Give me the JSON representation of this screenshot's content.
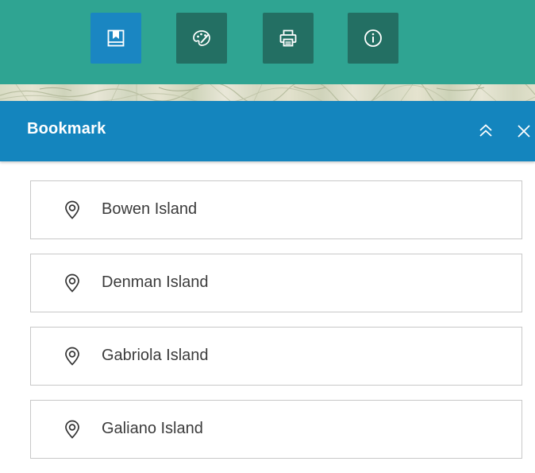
{
  "toolbar": {
    "buttons": [
      {
        "name": "bookmark",
        "icon": "bookmark-icon",
        "active": true
      },
      {
        "name": "basemap",
        "icon": "palette-icon",
        "active": false
      },
      {
        "name": "print",
        "icon": "printer-icon",
        "active": false
      },
      {
        "name": "about",
        "icon": "info-icon",
        "active": false
      }
    ],
    "colors": {
      "bar": "#2fa492",
      "button": "#236f63",
      "active_button": "#1a86c2"
    }
  },
  "panel": {
    "title": "Bookmark",
    "collapse_icon": "double-chevron-up-icon",
    "close_icon": "close-icon",
    "header_color": "#1485be"
  },
  "bookmarks": [
    {
      "label": "Bowen Island",
      "icon": "location-pin-icon"
    },
    {
      "label": "Denman Island",
      "icon": "location-pin-icon"
    },
    {
      "label": "Gabriola Island",
      "icon": "location-pin-icon"
    },
    {
      "label": "Galiano Island",
      "icon": "location-pin-icon"
    }
  ]
}
